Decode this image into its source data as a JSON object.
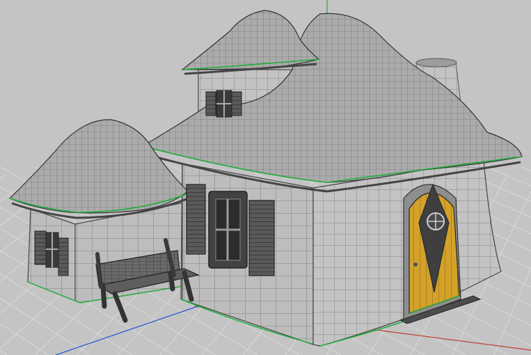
{
  "scene": {
    "subject": "",
    "render_style": "wireframe-over-shaded",
    "background_color": "#c4c4c4",
    "grid_color": "#d9d9d9",
    "axis_x_color": "#c0392b",
    "axis_y_color": "#2ea043",
    "axis_z_color": "#1f4fd1",
    "wall_color": "#bdbdbd",
    "roof_color": "#a9a9a9",
    "edge_highlight_color": "#1fae3a",
    "door_color": "#d4a22a",
    "shutter_color": "#4a4a4a"
  }
}
